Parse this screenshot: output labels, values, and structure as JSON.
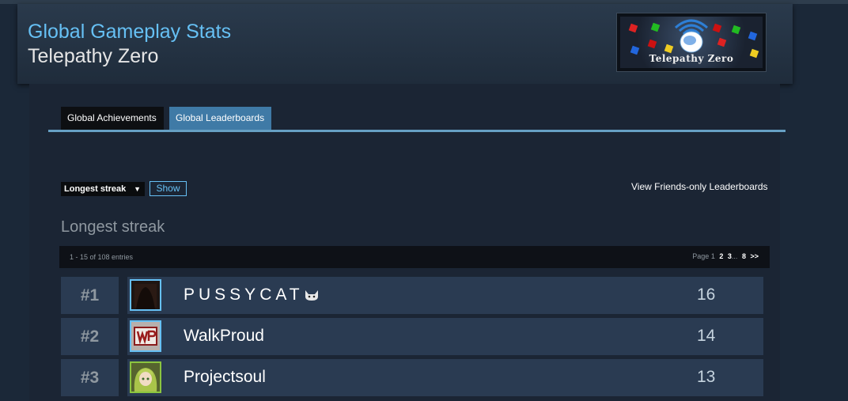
{
  "header": {
    "title": "Global Gameplay Stats",
    "game_name": "Telepathy Zero",
    "logo_text": "Telepathy Zero"
  },
  "tabs": [
    {
      "label": "Global Achievements",
      "active": false
    },
    {
      "label": "Global Leaderboards",
      "active": true
    }
  ],
  "controls": {
    "leaderboard_select": "Longest streak",
    "show_label": "Show",
    "friends_link": "View Friends-only Leaderboards"
  },
  "leaderboard": {
    "title": "Longest streak",
    "entries_summary": "1 - 15 of 108 entries",
    "pagination": {
      "prefix": "Page",
      "current": "1",
      "pages": [
        "2",
        "3"
      ],
      "ellipsis": "...",
      "last": "8",
      "next": ">>"
    },
    "rows": [
      {
        "rank": "#1",
        "name": "PUSSYCAT",
        "name_suffix_icon": "cat-face-icon",
        "score": "16",
        "avatar": "dark-avatar"
      },
      {
        "rank": "#2",
        "name": "WalkProud",
        "score": "14",
        "avatar": "wp-logo-avatar"
      },
      {
        "rank": "#3",
        "name": "Projectsoul",
        "score": "13",
        "avatar": "anime-girl-avatar"
      }
    ]
  },
  "colors": {
    "page_bg": "#1b2838",
    "accent_blue": "#66c0f4",
    "active_tab": "#3f7aa6",
    "row_bg": "#2a3b52",
    "online_green": "#8bc53f"
  }
}
